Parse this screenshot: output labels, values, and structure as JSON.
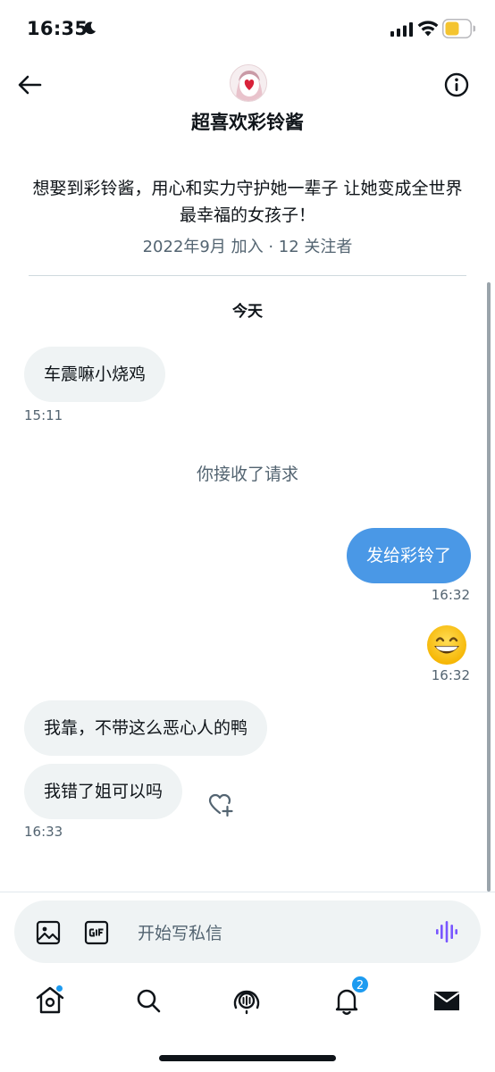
{
  "status_bar": {
    "time": "16:35",
    "icons": [
      "moon-icon",
      "signal-icon",
      "wifi-icon",
      "battery-icon"
    ]
  },
  "header": {
    "title": "超喜欢彩铃酱",
    "bio": "想娶到彩铃酱，用心和实力守护她一辈子 让她变成全世界最幸福的女孩子！",
    "meta": "2022年9月 加入 · 12 关注者",
    "icons": [
      "back-arrow-icon",
      "avatar",
      "info-icon"
    ]
  },
  "conversation": {
    "day_label": "今天",
    "messages": [
      {
        "direction": "in",
        "text": "车震嘛小烧鸡",
        "time": "15:11"
      },
      {
        "direction": "system",
        "text": "你接收了请求"
      },
      {
        "direction": "out",
        "text": "发给彩铃了",
        "time": "16:32"
      },
      {
        "direction": "out",
        "emoji": "grinning-face-emoji",
        "time": "16:32"
      },
      {
        "direction": "in",
        "text": "我靠，不带这么恶心人的鸭"
      },
      {
        "direction": "in",
        "text": "我错了姐可以吗",
        "time": "16:33"
      }
    ]
  },
  "composer": {
    "placeholder": "开始写私信",
    "icons": [
      "image-icon",
      "gif-icon",
      "voice-icon"
    ]
  },
  "bottom_nav": {
    "items": [
      "home-icon",
      "search-icon",
      "spaces-icon",
      "notifications-icon",
      "messages-icon"
    ],
    "notifications_badge": "2"
  },
  "colors": {
    "accent": "#1d9bf0",
    "outgoing_bubble": "#4a98e6",
    "incoming_bubble": "#eff3f4",
    "secondary_text": "#536471"
  }
}
